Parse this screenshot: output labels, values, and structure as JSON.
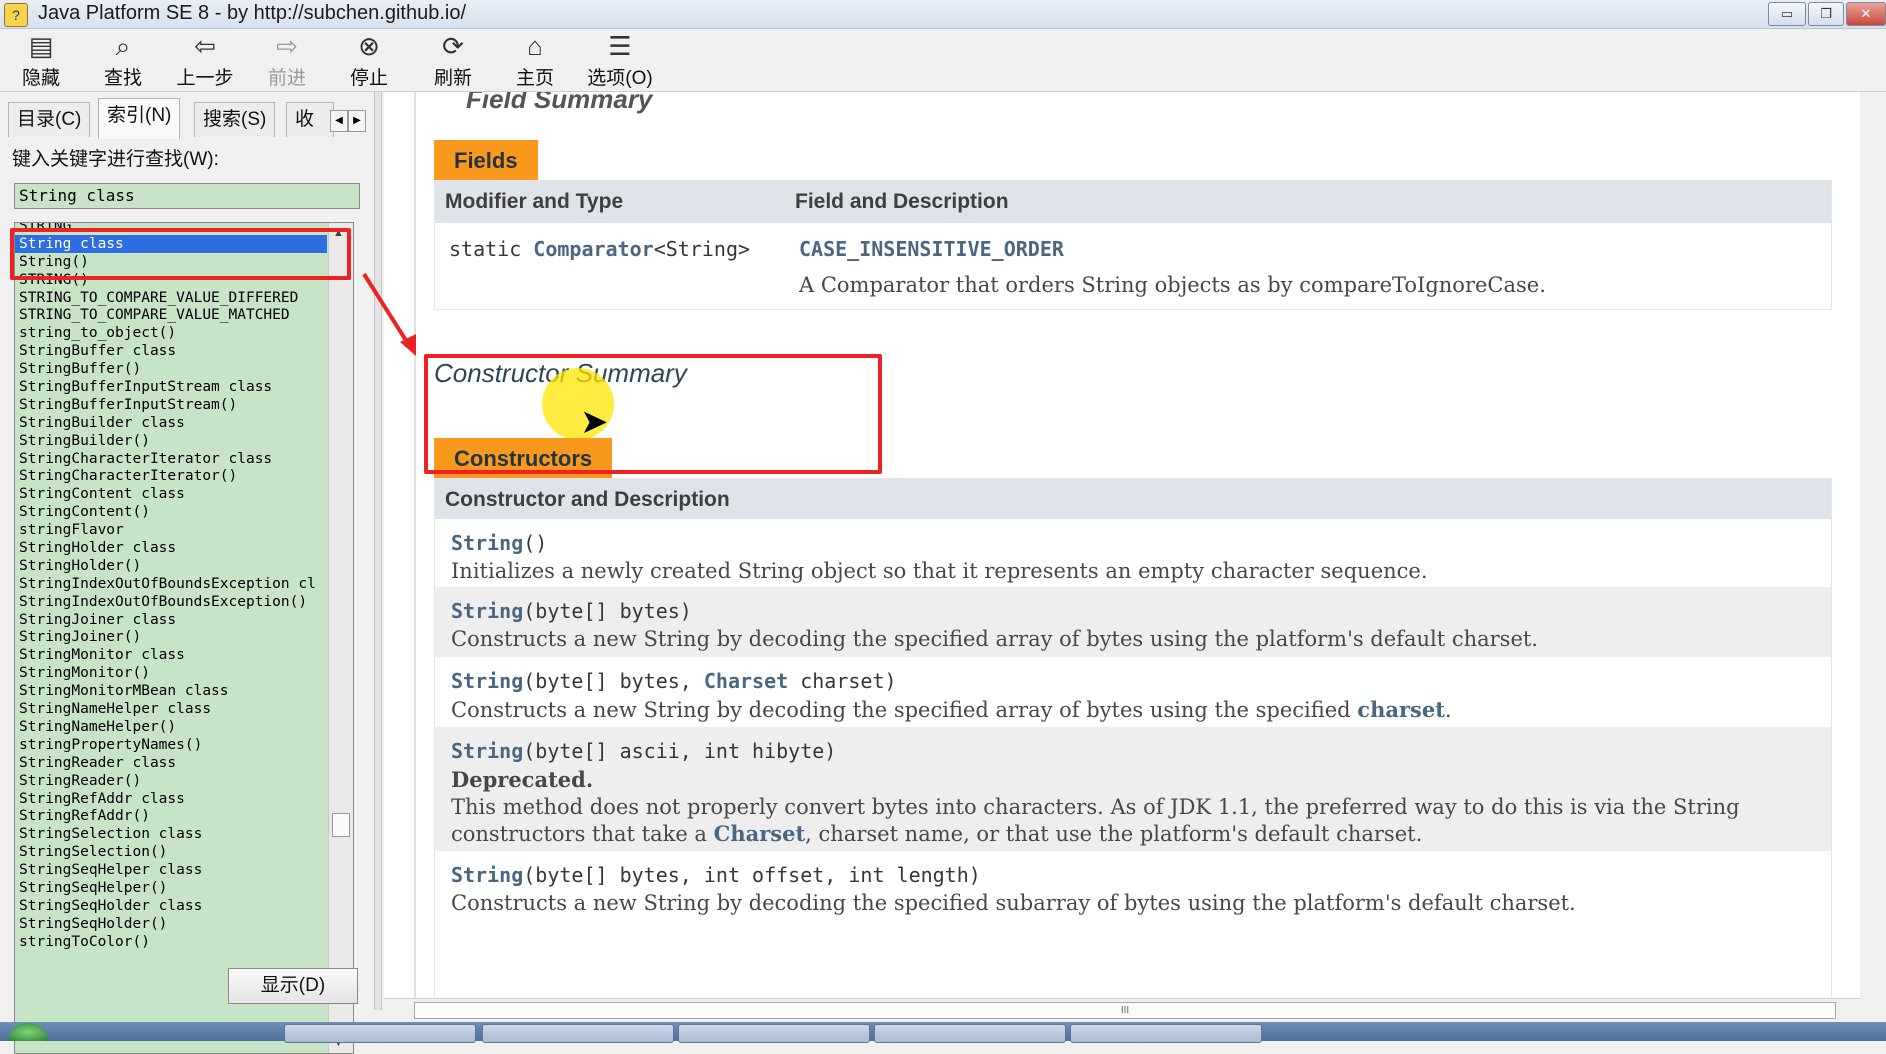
{
  "window": {
    "title": "Java Platform SE 8 - by http://subchen.github.io/",
    "controls": [
      "▭",
      "❐",
      "✕"
    ]
  },
  "toolbar": [
    {
      "label": "隐藏",
      "icon": "hide-icon",
      "glyph": "▤",
      "enabled": true
    },
    {
      "label": "查找",
      "icon": "find-icon",
      "glyph": "⌕",
      "enabled": true
    },
    {
      "label": "上一步",
      "icon": "back-icon",
      "glyph": "⇦",
      "enabled": true
    },
    {
      "label": "前进",
      "icon": "forward-icon",
      "glyph": "⇨",
      "enabled": false
    },
    {
      "label": "停止",
      "icon": "stop-icon",
      "glyph": "⊗",
      "enabled": true
    },
    {
      "label": "刷新",
      "icon": "refresh-icon",
      "glyph": "⟳",
      "enabled": true
    },
    {
      "label": "主页",
      "icon": "home-icon",
      "glyph": "⌂",
      "enabled": true
    },
    {
      "label": "选项(O)",
      "icon": "options-icon",
      "glyph": "☰",
      "enabled": true
    }
  ],
  "nav": {
    "tabs": [
      "目录(C)",
      "索引(N)",
      "搜索(S)",
      "收"
    ],
    "active_tab": "索引(N)",
    "keyword_label": "键入关键字进行查找(W):",
    "keyword_value": "String class",
    "show_button": "显示(D)",
    "selected_item": "String class",
    "items": [
      "STRING",
      "String class",
      "String()",
      "STRING()",
      "STRING_TO_COMPARE_VALUE_DIFFERED",
      "STRING_TO_COMPARE_VALUE_MATCHED",
      "string_to_object()",
      "StringBuffer class",
      "StringBuffer()",
      "StringBufferInputStream class",
      "StringBufferInputStream()",
      "StringBuilder class",
      "StringBuilder()",
      "StringCharacterIterator class",
      "StringCharacterIterator()",
      "StringContent class",
      "StringContent()",
      "stringFlavor",
      "StringHolder class",
      "StringHolder()",
      "StringIndexOutOfBoundsException cl",
      "StringIndexOutOfBoundsException()",
      "StringJoiner class",
      "StringJoiner()",
      "StringMonitor class",
      "StringMonitor()",
      "StringMonitorMBean class",
      "StringNameHelper class",
      "StringNameHelper()",
      "stringPropertyNames()",
      "StringReader class",
      "StringReader()",
      "StringRefAddr class",
      "StringRefAddr()",
      "StringSelection class",
      "StringSelection()",
      "StringSeqHelper class",
      "StringSeqHelper()",
      "StringSeqHolder class",
      "StringSeqHolder()",
      "stringToColor()"
    ]
  },
  "content": {
    "prev_section_heading": "Field Summary",
    "fields": {
      "caption": "Fields",
      "col1": "Modifier and Type",
      "col2": "Field and Description",
      "modifier_prefix": "static ",
      "type_link": "Comparator",
      "type_generic": "<String>",
      "field_name": "CASE_INSENSITIVE_ORDER",
      "field_desc": "A Comparator that orders String objects as by compareToIgnoreCase."
    },
    "constructor_summary": {
      "heading": "Constructor Summary",
      "caption": "Constructors",
      "header": "Constructor and Description",
      "rows": [
        {
          "name": "String",
          "params_pre": "()",
          "link": "",
          "params_post": "",
          "deprecated": "",
          "desc": "Initializes a newly created String object so that it represents an empty character sequence.",
          "desc_link": "",
          "desc_end": "",
          "desc2_pre": "",
          "desc2_link": "",
          "desc2_post": ""
        },
        {
          "name": "String",
          "params_pre": "(byte[] bytes)",
          "link": "",
          "params_post": "",
          "deprecated": "",
          "desc": "Constructs a new String by decoding the specified array of bytes using the platform's default charset.",
          "desc_link": "",
          "desc_end": "",
          "desc2_pre": "",
          "desc2_link": "",
          "desc2_post": ""
        },
        {
          "name": "String",
          "params_pre": "(byte[] bytes, ",
          "link": "Charset",
          "params_post": " charset)",
          "deprecated": "",
          "desc": "Constructs a new String by decoding the specified array of bytes using the specified ",
          "desc_link": "charset",
          "desc_end": ".",
          "desc2_pre": "",
          "desc2_link": "",
          "desc2_post": ""
        },
        {
          "name": "String",
          "params_pre": "(byte[] ascii, int hibyte)",
          "link": "",
          "params_post": "",
          "deprecated": "Deprecated.",
          "desc": "This method does not properly convert bytes into characters. As of JDK 1.1, the preferred way to do this is via the String",
          "desc_link": "",
          "desc_end": "",
          "desc2_pre": "constructors that take a ",
          "desc2_link": "Charset",
          "desc2_post": ", charset name, or that use the platform's default charset."
        },
        {
          "name": "String",
          "params_pre": "(byte[] bytes, int offset, int length)",
          "link": "",
          "params_post": "",
          "deprecated": "",
          "desc": "Constructs a new String by decoding the specified subarray of bytes using the platform's default charset.",
          "desc_link": "",
          "desc_end": "",
          "desc2_pre": "",
          "desc2_link": "",
          "desc2_post": ""
        }
      ]
    }
  },
  "annotations": {
    "color": "#ee2222"
  },
  "scrollbar": {
    "grip": "III"
  },
  "colors": {
    "orange_caption": "#f8981d",
    "table_header": "#dee3e9",
    "link": "#4a6782",
    "list_bg": "#c7e4c7",
    "selection": "#2f6ee0"
  }
}
